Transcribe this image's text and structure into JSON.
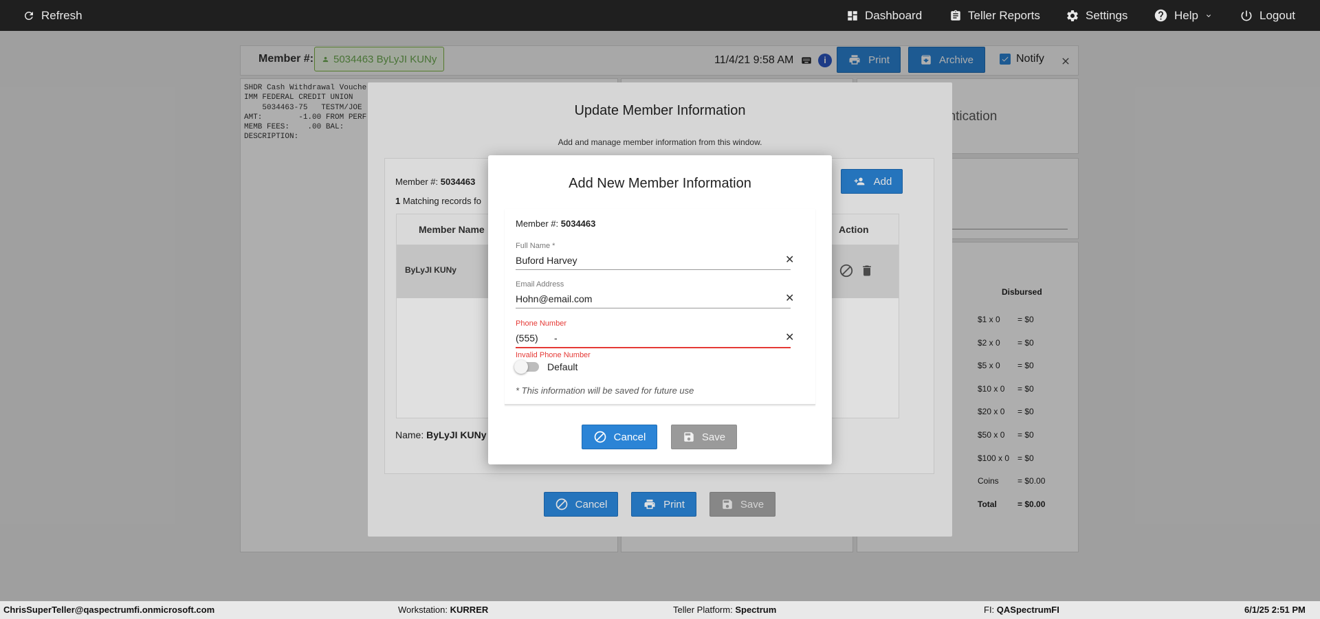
{
  "topbar": {
    "refresh": "Refresh",
    "dashboard": "Dashboard",
    "teller_reports": "Teller Reports",
    "settings": "Settings",
    "help": "Help",
    "logout": "Logout"
  },
  "header": {
    "member_label": "Member #:",
    "member_badge": "5034463 ByLyJI KUNy",
    "datetime": "11/4/21 9:58 AM",
    "print": "Print",
    "archive": "Archive",
    "notify": "Notify"
  },
  "receipt": {
    "lines": [
      "SHDR Cash Withdrawal Vouche",
      "IMM FEDERAL CREDIT UNION",
      "    5034463-75   TESTM/JOE",
      "AMT:        -1.00 FROM PERF",
      "MEMB FEES:    .00 BAL:",
      "DESCRIPTION:"
    ]
  },
  "right_panel": {
    "authentication_partial": "entication",
    "disbursed_header": "Disbursed",
    "rows": [
      {
        "denom": "$1 x 0",
        "value": "= $0"
      },
      {
        "denom": "$2 x 0",
        "value": "= $0"
      },
      {
        "denom": "$5 x 0",
        "value": "= $0"
      },
      {
        "denom": "$10 x 0",
        "value": "= $0"
      },
      {
        "denom": "$20 x 0",
        "value": "= $0"
      },
      {
        "denom": "$50 x 0",
        "value": "= $0"
      },
      {
        "denom": "$100 x 0",
        "value": "= $0"
      },
      {
        "denom": "Coins",
        "value": "= $0.00"
      }
    ],
    "total_label": "Total",
    "total_value": "= $0.00"
  },
  "update_modal": {
    "title": "Update Member Information",
    "subtitle": "Add and manage member information from this window.",
    "member_label": "Member #:",
    "member_number": "5034463",
    "add_button": "Add",
    "matching_count": "1",
    "matching_text": "Matching records fo",
    "col_member_name": "Member Name",
    "col_action": "Action",
    "row_name": "ByLyJI KUNy",
    "name_label": "Name:",
    "name_value": "ByLyJI KUNy",
    "cancel": "Cancel",
    "print": "Print",
    "save": "Save"
  },
  "add_modal": {
    "title": "Add New Member Information",
    "member_label": "Member #:",
    "member_number": "5034463",
    "full_name_label": "Full Name *",
    "full_name_value": "Buford Harvey",
    "email_label": "Email Address",
    "email_value": "Hohn@email.com",
    "phone_label": "Phone Number",
    "phone_value": "(555)      -",
    "phone_error": "Invalid Phone Number",
    "default_label": "Default",
    "note": "* This information will be saved for future use",
    "cancel": "Cancel",
    "save": "Save"
  },
  "statusbar": {
    "user": "ChrisSuperTeller@qaspectrumfi.onmicrosoft.com",
    "workstation_label": "Workstation:",
    "workstation": "KURRER",
    "platform_label": "Teller Platform:",
    "platform": "Spectrum",
    "fi_label": "FI:",
    "fi": "QASpectrumFI",
    "datetime": "6/1/25 2:51 PM"
  },
  "colors": {
    "accent_blue": "#2b84d6",
    "error_red": "#e53935",
    "member_badge_green": "#6aa84f",
    "topbar": "#1f1f1f"
  }
}
